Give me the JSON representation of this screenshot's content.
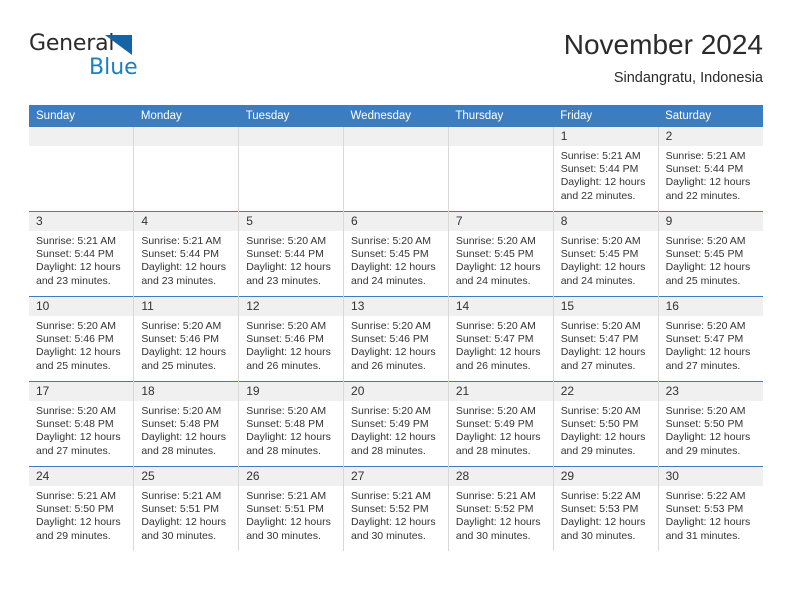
{
  "brand": {
    "name_part1": "General",
    "name_part2": "Blue",
    "triangle_color": "#1464a5",
    "blue_color": "#1b7fc4"
  },
  "header": {
    "title": "November 2024",
    "subtitle": "Sindangratu, Indonesia"
  },
  "theme": {
    "header_row_bg": "#3b7dc0",
    "daynum_bg": "#f0f0f0",
    "cell_border": "#d8d8d8",
    "text": "#333333"
  },
  "weekday_headers": [
    "Sunday",
    "Monday",
    "Tuesday",
    "Wednesday",
    "Thursday",
    "Friday",
    "Saturday"
  ],
  "labels": {
    "sunrise_prefix": "Sunrise:",
    "sunset_prefix": "Sunset:",
    "daylight_prefix": "Daylight:"
  },
  "weeks": [
    [
      {
        "day": "",
        "empty": true
      },
      {
        "day": "",
        "empty": true
      },
      {
        "day": "",
        "empty": true
      },
      {
        "day": "",
        "empty": true
      },
      {
        "day": "",
        "empty": true
      },
      {
        "day": "1",
        "sunrise": "Sunrise: 5:21 AM",
        "sunset": "Sunset: 5:44 PM",
        "daylight": "Daylight: 12 hours and 22 minutes."
      },
      {
        "day": "2",
        "sunrise": "Sunrise: 5:21 AM",
        "sunset": "Sunset: 5:44 PM",
        "daylight": "Daylight: 12 hours and 22 minutes."
      }
    ],
    [
      {
        "day": "3",
        "sunrise": "Sunrise: 5:21 AM",
        "sunset": "Sunset: 5:44 PM",
        "daylight": "Daylight: 12 hours and 23 minutes."
      },
      {
        "day": "4",
        "sunrise": "Sunrise: 5:21 AM",
        "sunset": "Sunset: 5:44 PM",
        "daylight": "Daylight: 12 hours and 23 minutes."
      },
      {
        "day": "5",
        "sunrise": "Sunrise: 5:20 AM",
        "sunset": "Sunset: 5:44 PM",
        "daylight": "Daylight: 12 hours and 23 minutes."
      },
      {
        "day": "6",
        "sunrise": "Sunrise: 5:20 AM",
        "sunset": "Sunset: 5:45 PM",
        "daylight": "Daylight: 12 hours and 24 minutes."
      },
      {
        "day": "7",
        "sunrise": "Sunrise: 5:20 AM",
        "sunset": "Sunset: 5:45 PM",
        "daylight": "Daylight: 12 hours and 24 minutes."
      },
      {
        "day": "8",
        "sunrise": "Sunrise: 5:20 AM",
        "sunset": "Sunset: 5:45 PM",
        "daylight": "Daylight: 12 hours and 24 minutes."
      },
      {
        "day": "9",
        "sunrise": "Sunrise: 5:20 AM",
        "sunset": "Sunset: 5:45 PM",
        "daylight": "Daylight: 12 hours and 25 minutes."
      }
    ],
    [
      {
        "day": "10",
        "sunrise": "Sunrise: 5:20 AM",
        "sunset": "Sunset: 5:46 PM",
        "daylight": "Daylight: 12 hours and 25 minutes."
      },
      {
        "day": "11",
        "sunrise": "Sunrise: 5:20 AM",
        "sunset": "Sunset: 5:46 PM",
        "daylight": "Daylight: 12 hours and 25 minutes."
      },
      {
        "day": "12",
        "sunrise": "Sunrise: 5:20 AM",
        "sunset": "Sunset: 5:46 PM",
        "daylight": "Daylight: 12 hours and 26 minutes."
      },
      {
        "day": "13",
        "sunrise": "Sunrise: 5:20 AM",
        "sunset": "Sunset: 5:46 PM",
        "daylight": "Daylight: 12 hours and 26 minutes."
      },
      {
        "day": "14",
        "sunrise": "Sunrise: 5:20 AM",
        "sunset": "Sunset: 5:47 PM",
        "daylight": "Daylight: 12 hours and 26 minutes."
      },
      {
        "day": "15",
        "sunrise": "Sunrise: 5:20 AM",
        "sunset": "Sunset: 5:47 PM",
        "daylight": "Daylight: 12 hours and 27 minutes."
      },
      {
        "day": "16",
        "sunrise": "Sunrise: 5:20 AM",
        "sunset": "Sunset: 5:47 PM",
        "daylight": "Daylight: 12 hours and 27 minutes."
      }
    ],
    [
      {
        "day": "17",
        "sunrise": "Sunrise: 5:20 AM",
        "sunset": "Sunset: 5:48 PM",
        "daylight": "Daylight: 12 hours and 27 minutes."
      },
      {
        "day": "18",
        "sunrise": "Sunrise: 5:20 AM",
        "sunset": "Sunset: 5:48 PM",
        "daylight": "Daylight: 12 hours and 28 minutes."
      },
      {
        "day": "19",
        "sunrise": "Sunrise: 5:20 AM",
        "sunset": "Sunset: 5:48 PM",
        "daylight": "Daylight: 12 hours and 28 minutes."
      },
      {
        "day": "20",
        "sunrise": "Sunrise: 5:20 AM",
        "sunset": "Sunset: 5:49 PM",
        "daylight": "Daylight: 12 hours and 28 minutes."
      },
      {
        "day": "21",
        "sunrise": "Sunrise: 5:20 AM",
        "sunset": "Sunset: 5:49 PM",
        "daylight": "Daylight: 12 hours and 28 minutes."
      },
      {
        "day": "22",
        "sunrise": "Sunrise: 5:20 AM",
        "sunset": "Sunset: 5:50 PM",
        "daylight": "Daylight: 12 hours and 29 minutes."
      },
      {
        "day": "23",
        "sunrise": "Sunrise: 5:20 AM",
        "sunset": "Sunset: 5:50 PM",
        "daylight": "Daylight: 12 hours and 29 minutes."
      }
    ],
    [
      {
        "day": "24",
        "sunrise": "Sunrise: 5:21 AM",
        "sunset": "Sunset: 5:50 PM",
        "daylight": "Daylight: 12 hours and 29 minutes."
      },
      {
        "day": "25",
        "sunrise": "Sunrise: 5:21 AM",
        "sunset": "Sunset: 5:51 PM",
        "daylight": "Daylight: 12 hours and 30 minutes."
      },
      {
        "day": "26",
        "sunrise": "Sunrise: 5:21 AM",
        "sunset": "Sunset: 5:51 PM",
        "daylight": "Daylight: 12 hours and 30 minutes."
      },
      {
        "day": "27",
        "sunrise": "Sunrise: 5:21 AM",
        "sunset": "Sunset: 5:52 PM",
        "daylight": "Daylight: 12 hours and 30 minutes."
      },
      {
        "day": "28",
        "sunrise": "Sunrise: 5:21 AM",
        "sunset": "Sunset: 5:52 PM",
        "daylight": "Daylight: 12 hours and 30 minutes."
      },
      {
        "day": "29",
        "sunrise": "Sunrise: 5:22 AM",
        "sunset": "Sunset: 5:53 PM",
        "daylight": "Daylight: 12 hours and 30 minutes."
      },
      {
        "day": "30",
        "sunrise": "Sunrise: 5:22 AM",
        "sunset": "Sunset: 5:53 PM",
        "daylight": "Daylight: 12 hours and 31 minutes."
      }
    ]
  ]
}
